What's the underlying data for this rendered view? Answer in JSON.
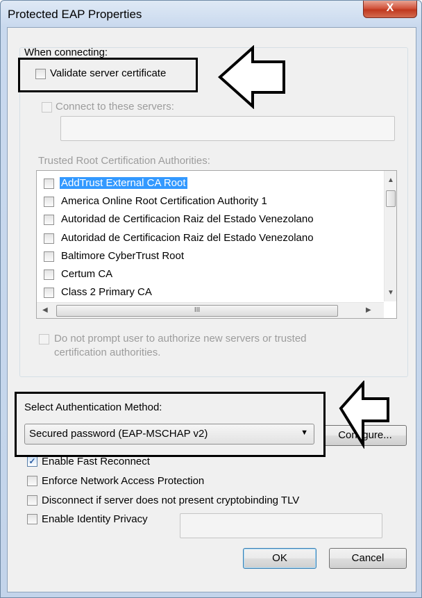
{
  "window": {
    "title": "Protected EAP Properties",
    "close_glyph": "X"
  },
  "connecting": {
    "heading": "When connecting:",
    "validate_label": "Validate server certificate",
    "connect_label": "Connect to these servers:",
    "servers_value": "",
    "trusted_label": "Trusted Root Certification Authorities:",
    "ca_list": [
      {
        "label": "AddTrust External CA Root",
        "selected": true
      },
      {
        "label": "America Online Root Certification Authority 1",
        "selected": false
      },
      {
        "label": "Autoridad de Certificacion Raiz del Estado Venezolano",
        "selected": false
      },
      {
        "label": "Autoridad de Certificacion Raiz del Estado Venezolano",
        "selected": false
      },
      {
        "label": "Baltimore CyberTrust Root",
        "selected": false
      },
      {
        "label": "Certum CA",
        "selected": false
      },
      {
        "label": "Class 2 Primary CA",
        "selected": false
      }
    ],
    "scroll_grip": "III",
    "prompt_line1": "Do not prompt user to authorize new servers or trusted",
    "prompt_line2": "certification authorities."
  },
  "auth": {
    "heading": "Select Authentication Method:",
    "method_value": "Secured password (EAP-MSCHAP v2)",
    "configure_label": "Configure..."
  },
  "options": {
    "fast_reconnect": {
      "label": "Enable Fast Reconnect",
      "checked": true
    },
    "nap": {
      "label": "Enforce Network Access Protection",
      "checked": false
    },
    "cryptobinding": {
      "label": "Disconnect if server does not present cryptobinding TLV",
      "checked": false
    },
    "identity_privacy": {
      "label": "Enable Identity Privacy",
      "checked": false
    },
    "identity_value": ""
  },
  "buttons": {
    "ok": "OK",
    "cancel": "Cancel"
  },
  "icons": [
    "close-icon",
    "checkmark-icon",
    "dropdown-arrow-icon",
    "scroll-up-icon",
    "scroll-down-icon",
    "scroll-left-icon",
    "scroll-right-icon",
    "annotation-arrow-icon"
  ],
  "colors": {
    "selection": "#3399ff",
    "title_bar": "#c9d9ee",
    "close_button": "#c7432a"
  }
}
